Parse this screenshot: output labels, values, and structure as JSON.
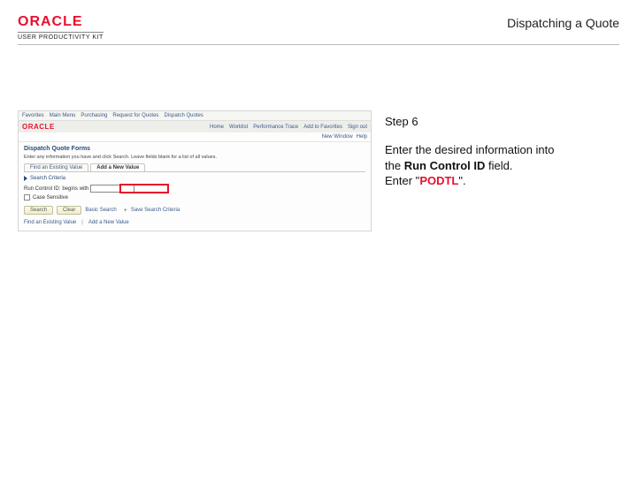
{
  "header": {
    "brand_main": "ORACLE",
    "brand_sub": "USER PRODUCTIVITY KIT",
    "page_title": "Dispatching a Quote"
  },
  "instructions": {
    "step_label": "Step 6",
    "line1": "Enter the desired information into",
    "line2_pre": "the ",
    "line2_bold": "Run Control ID",
    "line2_post": " field.",
    "line3_pre": "Enter \"",
    "line3_emph": "PODTL",
    "line3_post": "\"."
  },
  "screenshot": {
    "breadcrumbs": [
      "Favorites",
      "Main Menu",
      "Purchasing",
      "Request for Quotes",
      "Dispatch Quotes"
    ],
    "env": "",
    "logo": "ORACLE",
    "top_links": [
      "Home",
      "Worklist",
      "Performance Trace",
      "Add to Favorites",
      "Sign out"
    ],
    "newwin_label": "New Window",
    "help_label": "Help",
    "form_title": "Dispatch Quote Forms",
    "desc": "Enter any information you have and click Search. Leave fields blank for a list of all values.",
    "tab1": "Find an Existing Value",
    "tab2": "Add a New Value",
    "expand_section": "Search Criteria",
    "field_label": "Run Control ID:",
    "field_op": "begins with",
    "chk_label": "Case Sensitive",
    "btn_search": "Search",
    "btn_clear": "Clear",
    "basic_link": "Basic Search",
    "save_link": "Save Search Criteria",
    "plus_icon": "+",
    "footer1": "Find an Existing Value",
    "footer2": "Add a New Value"
  }
}
